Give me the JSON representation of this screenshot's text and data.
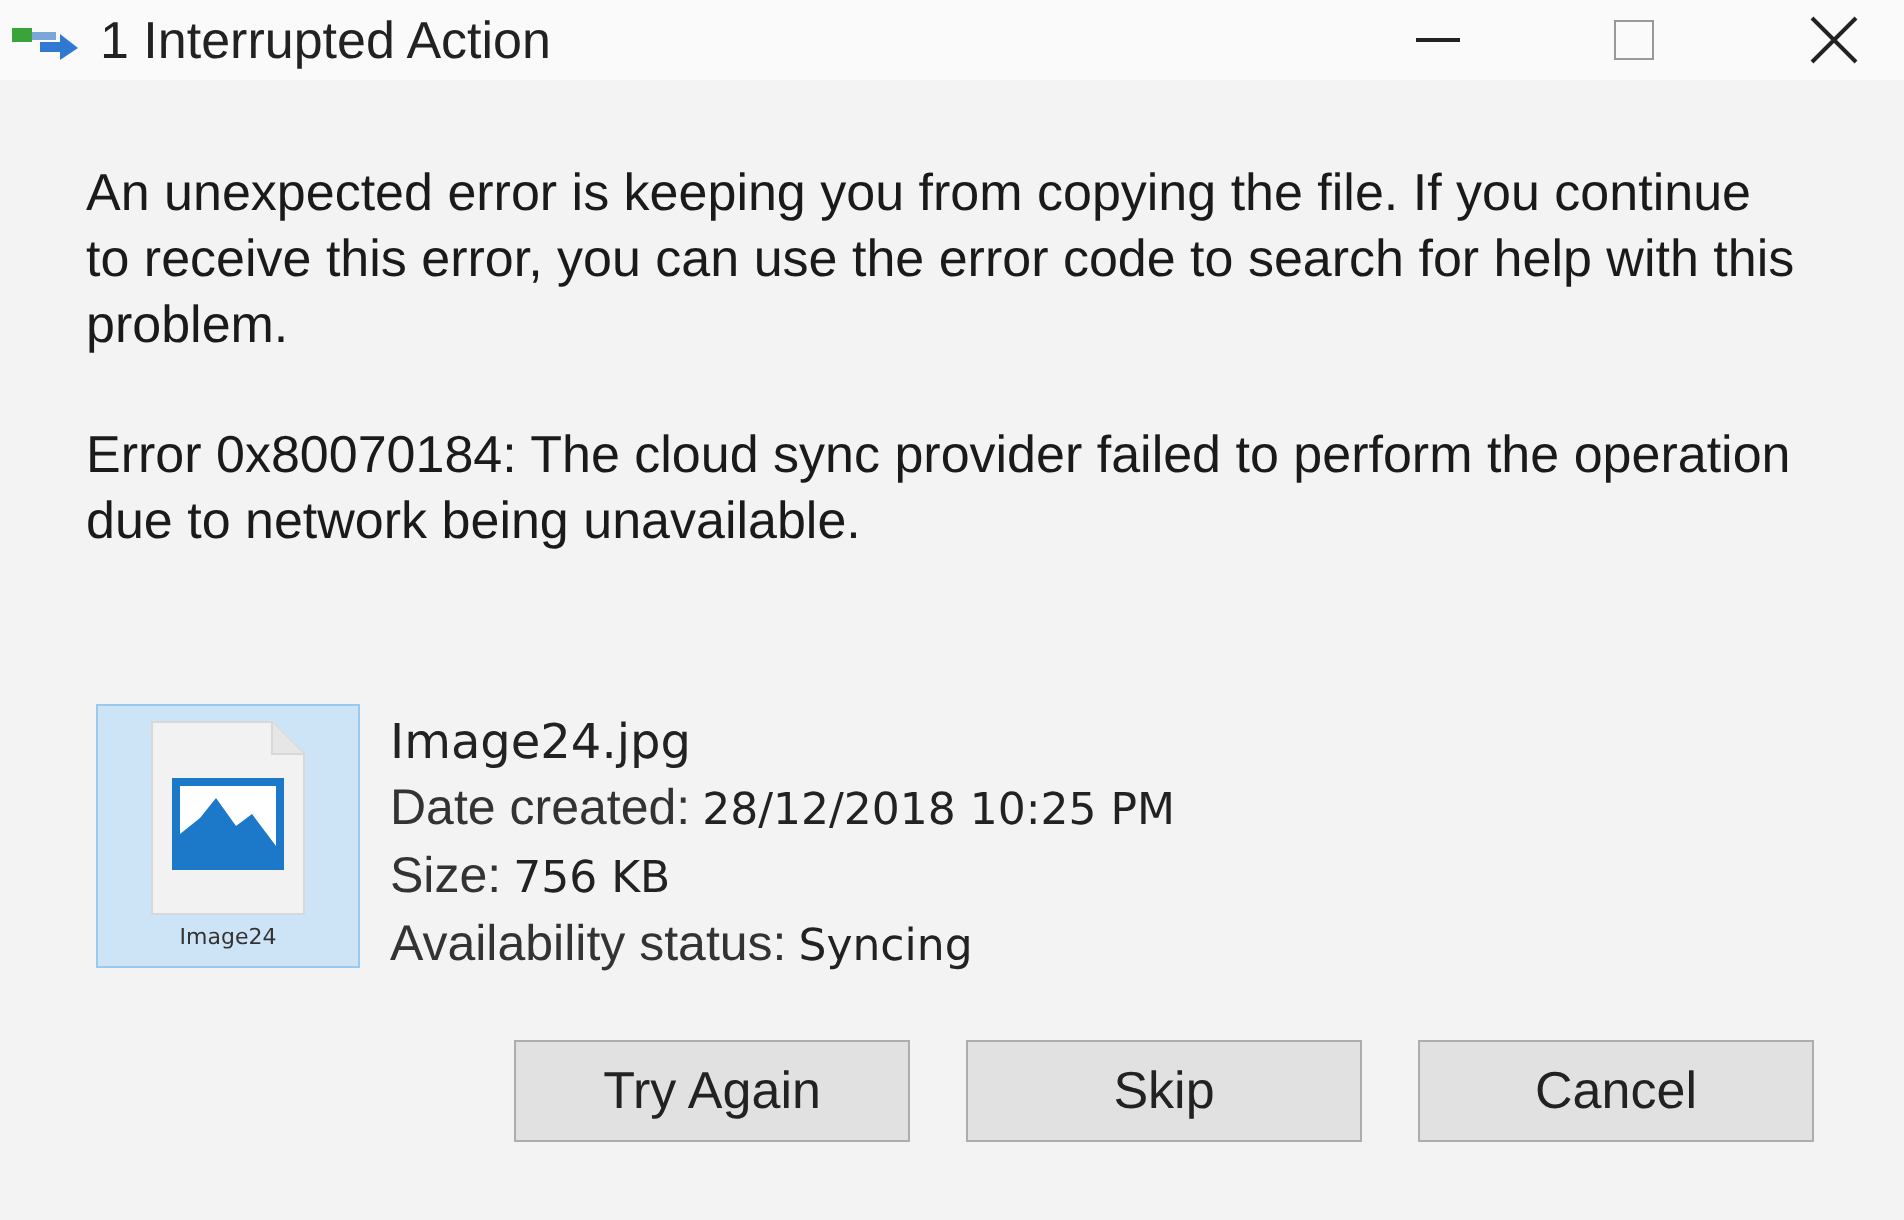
{
  "window": {
    "title": "1 Interrupted Action"
  },
  "message": "An unexpected error is keeping you from copying the file. If you continue to receive this error, you can use the error code to search for help with this problem.",
  "error": "Error 0x80070184: The cloud sync provider failed to perform the operation due to network being unavailable.",
  "file": {
    "selected": true,
    "thumbnail_caption": "Image24",
    "name": "Image24.jpg",
    "details": [
      {
        "label": "Date created:",
        "value": "28/12/2018 10:25 PM"
      },
      {
        "label": "Size:",
        "value": "756 KB"
      },
      {
        "label": "Availability status:",
        "value": "Syncing"
      }
    ]
  },
  "buttons": [
    "Try Again",
    "Skip",
    "Cancel"
  ]
}
